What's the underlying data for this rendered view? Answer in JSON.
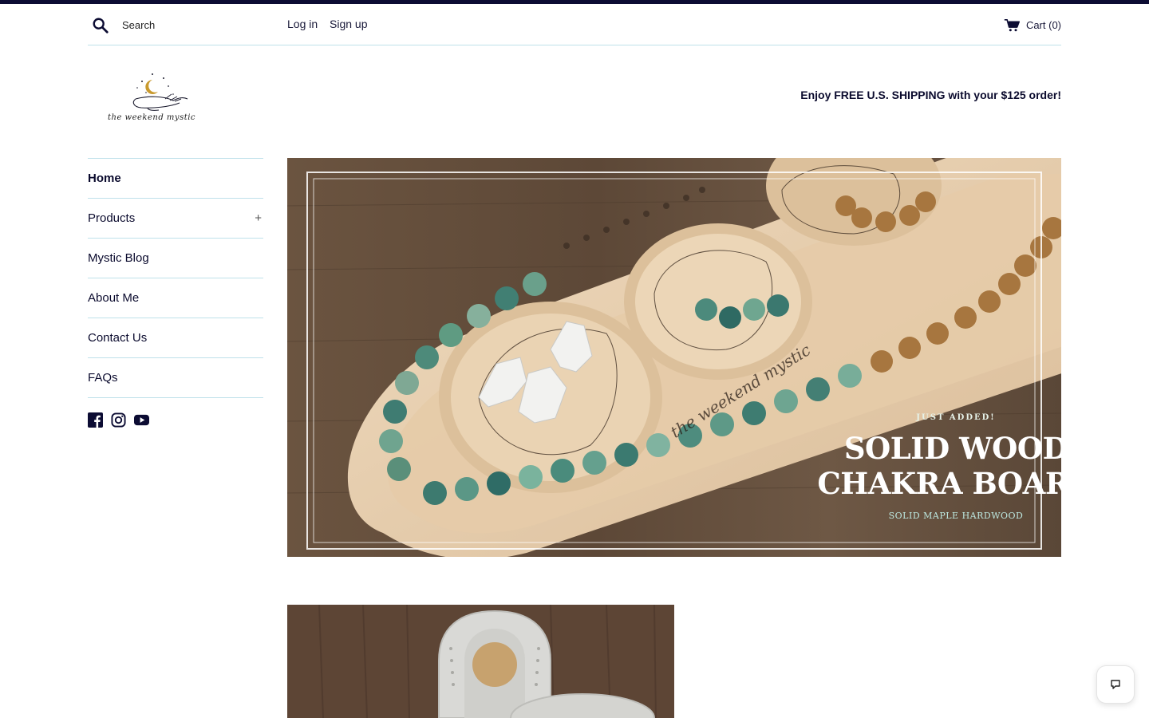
{
  "header": {
    "search_placeholder": "Search",
    "login_label": "Log in",
    "signup_label": "Sign up",
    "cart_label": "Cart (0)"
  },
  "brand": {
    "logo_text": "the weekend mystic",
    "promo_text": "Enjoy FREE U.S. SHIPPING with your $125 order!"
  },
  "sidebar": {
    "items": [
      {
        "label": "Home",
        "active": true
      },
      {
        "label": "Products",
        "expandable": true,
        "toggle": "+"
      },
      {
        "label": "Mystic Blog"
      },
      {
        "label": "About Me"
      },
      {
        "label": "Contact Us"
      },
      {
        "label": "FAQs"
      }
    ],
    "social": [
      "facebook-icon",
      "instagram-icon",
      "youtube-icon"
    ]
  },
  "hero": {
    "board_engraving": "the weekend mystic",
    "kicker": "JUST ADDED!",
    "title_line1": "SOLID WOOD",
    "title_line2": "CHAKRA BOARD",
    "subtitle": "SOLID MAPLE HARDWOOD"
  },
  "colors": {
    "accent": "#0c0c33",
    "divider": "#bfe1ea",
    "text": "#0b0b2e"
  },
  "icons": {
    "search": "search-icon",
    "cart": "cart-icon",
    "chat": "chat-icon"
  }
}
